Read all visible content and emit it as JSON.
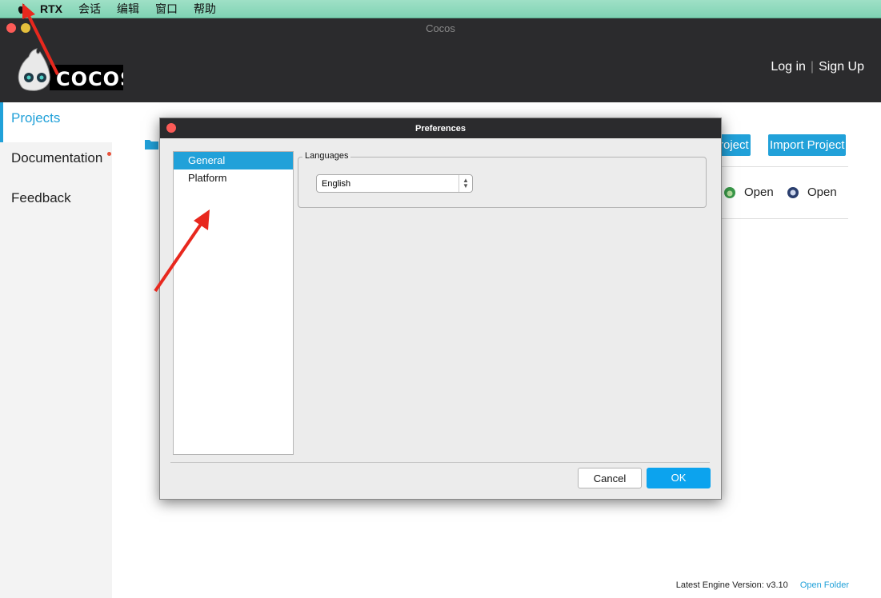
{
  "menubar": {
    "items": [
      "RTX",
      "会话",
      "编辑",
      "窗口",
      "帮助"
    ]
  },
  "window": {
    "title": "Cocos"
  },
  "header": {
    "logo_text": "COCOS",
    "login": "Log in",
    "signup": "Sign Up"
  },
  "sidebar": {
    "items": [
      {
        "label": "Projects"
      },
      {
        "label": "Documentation"
      },
      {
        "label": "Feedback"
      }
    ]
  },
  "main": {
    "new_project_partial": "roject",
    "import_project": "Import Project",
    "open_items": [
      "Open",
      "Open"
    ],
    "footer": {
      "engine_version": "Latest Engine Version: v3.10",
      "open_folder": "Open Folder"
    }
  },
  "dialog": {
    "title": "Preferences",
    "categories": [
      "General",
      "Platform"
    ],
    "languages_label": "Languages",
    "language_value": "English",
    "cancel": "Cancel",
    "ok": "OK"
  },
  "colors": {
    "accent": "#21a1d9",
    "dark": "#2b2b2d",
    "annotation": "#e8281e"
  }
}
